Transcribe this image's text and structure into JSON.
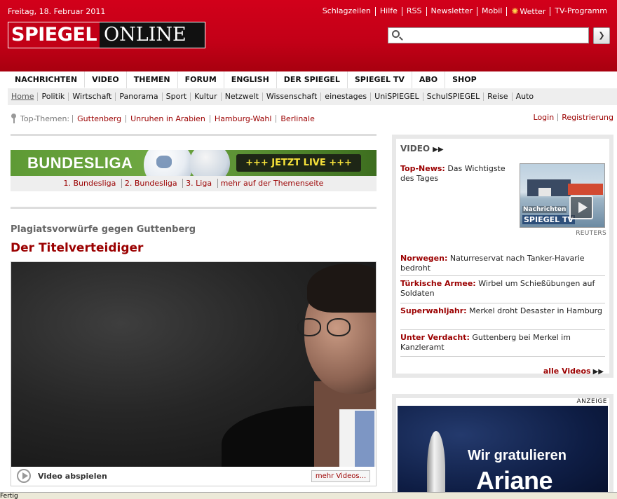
{
  "header": {
    "date": "Freitag, 18. Februar 2011",
    "toplinks": [
      "Schlagzeilen",
      "Hilfe",
      "RSS",
      "Newsletter",
      "Mobil",
      "Wetter",
      "TV-Programm"
    ],
    "logo_left": "SPIEGEL",
    "logo_right": "ONLINE",
    "search": {
      "value": "",
      "placeholder": ""
    },
    "search_button": "❯"
  },
  "mainnav": [
    "NACHRICHTEN",
    "VIDEO",
    "THEMEN",
    "FORUM",
    "ENGLISH",
    "DER SPIEGEL",
    "SPIEGEL TV",
    "ABO",
    "SHOP"
  ],
  "subnav": [
    "Home",
    "Politik",
    "Wirtschaft",
    "Panorama",
    "Sport",
    "Kultur",
    "Netzwelt",
    "Wissenschaft",
    "einestages",
    "UniSPIEGEL",
    "SchulSPIEGEL",
    "Reise",
    "Auto"
  ],
  "topthemen": {
    "label": "Top-Themen:",
    "links": [
      "Guttenberg",
      "Unruhen in Arabien",
      "Hamburg-Wahl",
      "Berlinale"
    ]
  },
  "userlinks": [
    "Login",
    "Registrierung"
  ],
  "bundesliga": {
    "title": "BUNDESLIGA",
    "live": "+++ JETZT LIVE +++",
    "links": [
      "1. Bundesliga",
      "2. Bundesliga",
      "3. Liga",
      "mehr auf der Themenseite"
    ]
  },
  "article": {
    "kicker": "Plagiatsvorwürfe gegen Guttenberg",
    "headline": "Der Titelverteidiger",
    "play_label": "Video abspielen",
    "more_videos": "mehr Videos..."
  },
  "video_box": {
    "title": "VIDEO",
    "arrows": "▶▶",
    "top_news": {
      "kicker": "Top-News:",
      "text": "Das Wichtigste des Tages"
    },
    "thumb_logo_1": "Nachrichten",
    "thumb_logo_2": "SPIEGEL TV",
    "credit": "REUTERS",
    "items": [
      {
        "kicker": "Norwegen:",
        "text": "Naturreservat nach Tanker-Havarie bedroht"
      },
      {
        "kicker": "Türkische Armee:",
        "text": "Wirbel um Schießübungen auf Soldaten"
      },
      {
        "kicker": "Superwahljahr:",
        "text": "Merkel droht Desaster in Hamburg"
      },
      {
        "kicker": "Unter Verdacht:",
        "text": "Guttenberg bei Merkel im Kanzleramt"
      }
    ],
    "all_videos": "alle Videos",
    "all_arrows": "▶▶"
  },
  "ad": {
    "label": "ANZEIGE",
    "line1": "Wir gratulieren",
    "line2": "Ariane"
  },
  "status": {
    "text": "Fertig"
  }
}
